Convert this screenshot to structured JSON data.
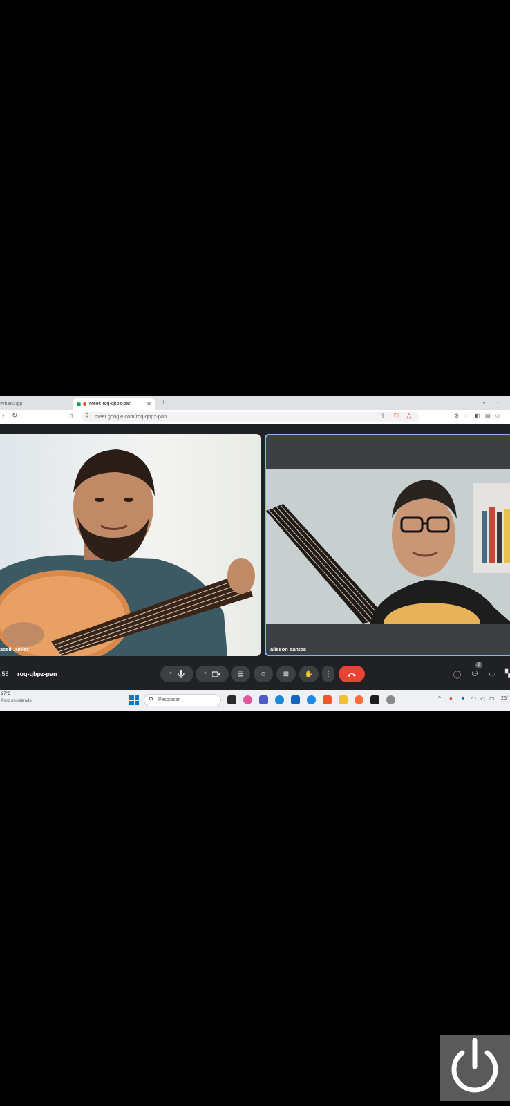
{
  "browser": {
    "tabs": [
      {
        "label": "WhatsApp",
        "active": false
      },
      {
        "label": "Meet: roq-qbpz-pan",
        "active": true
      }
    ],
    "url": "meet.google.com/roq-qbpz-pan"
  },
  "meet": {
    "participants": [
      {
        "name": "acell Junior"
      },
      {
        "name": "alisson santos"
      }
    ],
    "time": ":55",
    "meeting_code": "roq-qbpz-pan",
    "participant_count": "2"
  },
  "taskbar": {
    "weather_temp": "27°C",
    "weather_desc": "Parc ensolarado",
    "search_placeholder": "Pesquisar",
    "clock": "25/"
  },
  "colors": {
    "meet_bg": "#202124",
    "control_bg": "#3c4043",
    "end_call": "#ea4335",
    "active_border": "#8ab4f8"
  }
}
